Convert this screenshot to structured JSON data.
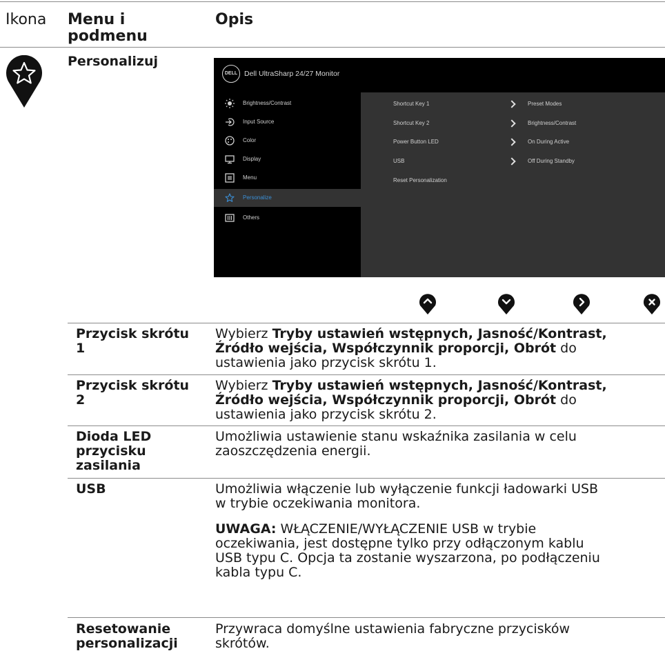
{
  "header": {
    "col_icon": "Ikona",
    "col_menu_line1": "Menu i",
    "col_menu_line2": "podmenu",
    "col_desc": "Opis"
  },
  "section_title": "Personalizuj",
  "section_icon": "star-icon",
  "osd": {
    "logo_text": "DELL",
    "title": "Dell UltraSharp 24/27 Monitor",
    "menu": [
      {
        "label": "Brightness/Contrast",
        "icon": "sun-icon"
      },
      {
        "label": "Input Source",
        "icon": "input-arrow-icon"
      },
      {
        "label": "Color",
        "icon": "palette-icon"
      },
      {
        "label": "Display",
        "icon": "monitor-icon"
      },
      {
        "label": "Menu",
        "icon": "menu-list-icon"
      },
      {
        "label": "Personalize",
        "icon": "star-icon",
        "selected": true
      },
      {
        "label": "Others",
        "icon": "others-icon"
      }
    ],
    "rows": [
      {
        "label": "Shortcut Key 1",
        "value": "Preset Modes"
      },
      {
        "label": "Shortcut Key 2",
        "value": "Brightness/Contrast"
      },
      {
        "label": "Power Button LED",
        "value": "On During Active"
      },
      {
        "label": "USB",
        "value": "Off During Standby"
      },
      {
        "label": "Reset Personalization",
        "value": ""
      }
    ],
    "accent_color": "#3b8fd6"
  },
  "nav_buttons": [
    "up-button-icon",
    "down-button-icon",
    "right-button-icon",
    "close-button-icon"
  ],
  "entries": {
    "sk1": {
      "name_line1": "Przycisk skrótu",
      "name_line2": "1",
      "desc_pre": "Wybierz ",
      "desc_bold_line1": "Tryby ustawień wstępnych, Jasność/Kontrast,",
      "desc_bold_line2": "Źródło wejścia, Współczynnik proporcji, Obrót",
      "desc_post_line2": " do",
      "desc_line3": "ustawienia jako przycisk skrótu 1."
    },
    "sk2": {
      "name_line1": "Przycisk skrótu",
      "name_line2": "2",
      "desc_pre": "Wybierz ",
      "desc_bold_line1": "Tryby ustawień wstępnych, Jasność/Kontrast,",
      "desc_bold_line2": "Źródło wejścia, Współczynnik proporcji, Obrót",
      "desc_post_line2": " do",
      "desc_line3": "ustawienia jako przycisk skrótu 2."
    },
    "led": {
      "name_line1": "Dioda LED",
      "name_line2": "przycisku",
      "name_line3": "zasilania",
      "desc_line1": "Umożliwia ustawienie stanu wskaźnika zasilania w celu",
      "desc_line2": "zaoszczędzenia energii."
    },
    "usb": {
      "name_line1": "USB",
      "desc_line1": "Umożliwia włączenie lub wyłączenie funkcji ładowarki USB",
      "desc_line2": "w trybie oczekiwania monitora.",
      "note_label": "UWAGA:",
      "note_line1": " WŁĄCZENIE/WYŁĄCZENIE USB w trybie",
      "note_line2": "oczekiwania, jest dostępne tylko przy odłączonym kablu",
      "note_line3": "USB typu C. Opcja ta zostanie wyszarzona, po podłączeniu",
      "note_line4": "kabla typu C."
    },
    "reset": {
      "name_line1": "Resetowanie",
      "name_line2": "personalizacji",
      "desc_line1": "Przywraca domyślne ustawienia fabryczne przycisków",
      "desc_line2": "skrótów."
    }
  }
}
